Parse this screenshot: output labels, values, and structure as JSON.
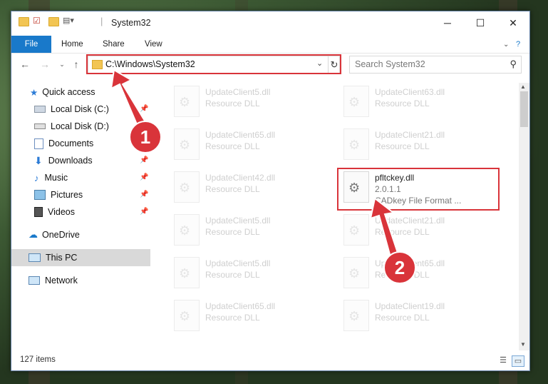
{
  "window": {
    "title": "System32"
  },
  "ribbon": {
    "file": "File",
    "home": "Home",
    "share": "Share",
    "view": "View"
  },
  "address": {
    "path": "C:\\Windows\\System32"
  },
  "search": {
    "placeholder": "Search System32"
  },
  "nav": {
    "quick_access": "Quick access",
    "items": [
      "Local Disk (C:)",
      "Local Disk (D:)",
      "Documents",
      "Downloads",
      "Music",
      "Pictures",
      "Videos"
    ],
    "onedrive": "OneDrive",
    "this_pc": "This PC",
    "network": "Network"
  },
  "files": [
    {
      "name": "UpdateClient5.dll",
      "type": "Resource DLL"
    },
    {
      "name": "UpdateClient63.dll",
      "type": "Resource DLL"
    },
    {
      "name": "UpdateClient65.dll",
      "type": "Resource DLL"
    },
    {
      "name": "UpdateClient21.dll",
      "type": "Resource DLL"
    },
    {
      "name": "UpdateClient42.dll",
      "type": "Resource DLL"
    },
    {
      "name": "pfltckey.dll",
      "type": "2.0.1.1",
      "desc": "CADkey File Format ..."
    },
    {
      "name": "UpdateClient5.dll",
      "type": "Resource DLL"
    },
    {
      "name": "UpdateClient21.dll",
      "type": "Resource DLL"
    },
    {
      "name": "UpdateClient5.dll",
      "type": "Resource DLL"
    },
    {
      "name": "UpdateClient65.dll",
      "type": "Resource DLL"
    },
    {
      "name": "UpdateClient65.dll",
      "type": "Resource DLL"
    },
    {
      "name": "UpdateClient19.dll",
      "type": "Resource DLL"
    }
  ],
  "status": {
    "count": "127 items"
  },
  "callouts": {
    "one": "1",
    "two": "2"
  },
  "colors": {
    "accent": "#1979ca",
    "highlight": "#d9343a"
  }
}
